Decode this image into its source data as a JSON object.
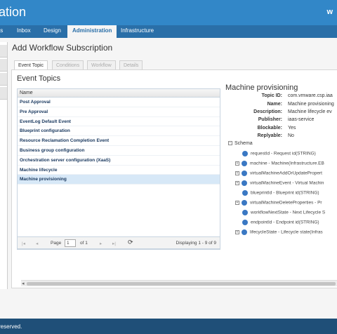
{
  "header": {
    "app_title": "ation",
    "user_partial": "w"
  },
  "nav": {
    "tabs": [
      "ts",
      "Inbox",
      "Design",
      "Administration",
      "Infrastructure"
    ],
    "active": "Administration"
  },
  "page": {
    "title": "Add Workflow Subscription"
  },
  "wizard_tabs": [
    "Event Topic",
    "Conditions",
    "Workflow",
    "Details"
  ],
  "event_topics": {
    "title": "Event Topics",
    "column": "Name",
    "rows": [
      "Post Approval",
      "Pre Approval",
      "EventLog Default Event",
      "Blueprint configuration",
      "Resource Reclamation Completion Event",
      "Business group configuration",
      "Orchestration server configuration (XaaS)",
      "Machine lifecycle",
      "Machine provisioning"
    ],
    "selected_index": 8
  },
  "pager": {
    "page_label": "Page",
    "page_value": "1",
    "of_label": "of 1",
    "displaying": "Displaying 1 - 9 of 9"
  },
  "detail": {
    "title": "Machine provisioning",
    "fields": [
      {
        "key": "Topic ID:",
        "value": "com.vmware.csp.iaa"
      },
      {
        "key": "Name:",
        "value": "Machine provisioning"
      },
      {
        "key": "Description:",
        "value": "Machine lifecycle ev"
      },
      {
        "key": "Publisher:",
        "value": "iaas-service"
      },
      {
        "key": "Blockable:",
        "value": "Yes"
      },
      {
        "key": "Replyable:",
        "value": "No"
      }
    ],
    "schema_label": "Schema",
    "schema_items": [
      {
        "text": "requestId - Request id(STRING)",
        "expandable": false
      },
      {
        "text": "machine - Machine(Infrastructure.EB",
        "expandable": true
      },
      {
        "text": "virtualMachineAddOrUpdatePropert",
        "expandable": true
      },
      {
        "text": "virtualMachineEvent - Virtual Machin",
        "expandable": true
      },
      {
        "text": "blueprintId - Blueprint id(STRING)",
        "expandable": false
      },
      {
        "text": "virtualMachineDeleteProperties - Pr",
        "expandable": true
      },
      {
        "text": "workflowNextState - Next Lifecycle S",
        "expandable": false
      },
      {
        "text": "endpointId - Endpoint id(STRING)",
        "expandable": false
      },
      {
        "text": "lifecycleState - Lifecycle state(Infras",
        "expandable": true
      }
    ]
  },
  "footer": {
    "text": "reserved."
  },
  "colors": {
    "header": "#3287c8",
    "nav": "#2a6fa8",
    "footer": "#1f4f78",
    "selected_row": "#d7e8f7"
  }
}
